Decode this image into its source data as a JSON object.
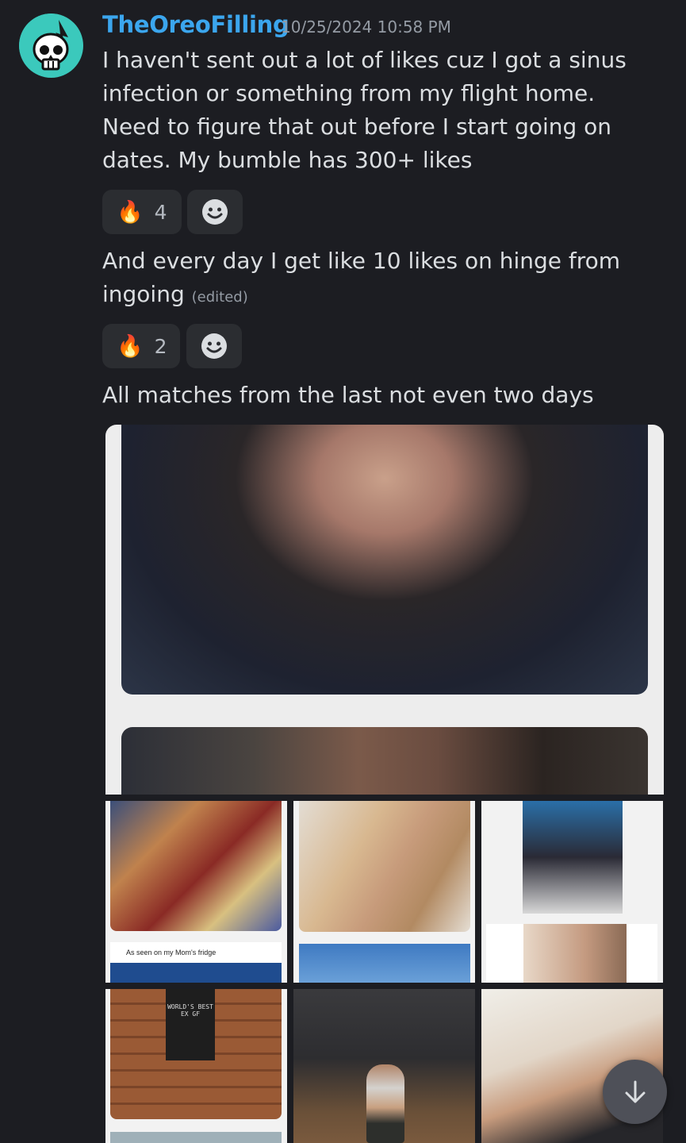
{
  "message": {
    "username": "TheOreoFilling",
    "timestamp": "10/25/2024 10:58 PM",
    "username_color": "#3ba6ee",
    "avatar_color": "#3bc9bc"
  },
  "messages": [
    {
      "text": "I haven't sent out a lot of likes cuz I got a sinus infection or something from my flight home. Need to figure that out before I start going on dates. My bumble has 300+ likes",
      "reaction": {
        "emoji": "🔥",
        "count": "4"
      }
    },
    {
      "text": "And every day I get like 10 likes on hinge from ingoing",
      "edited": "(edited)",
      "reaction": {
        "emoji": "🔥",
        "count": "2"
      }
    },
    {
      "text": "All matches from the last not even two days"
    }
  ],
  "attachments": {
    "main_image": "dating profile screenshot",
    "caption": "As seen on my Mom's fridge",
    "shirt_text": "WORLD'S BEST EX GF"
  },
  "icons": {
    "add_reaction": "smiley-icon",
    "scroll_down": "arrow-down-icon"
  }
}
